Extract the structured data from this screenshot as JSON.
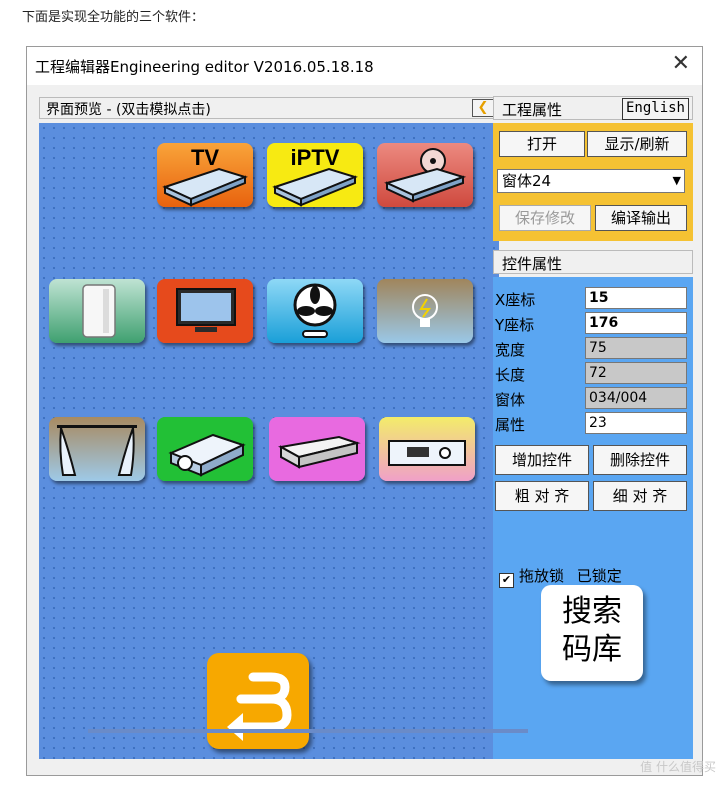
{
  "caption": "下面是实现全功能的三个软件：",
  "window": {
    "title": "工程编辑器Engineering editor V2016.05.18.18",
    "close_glyph": "✕"
  },
  "preview": {
    "header": "界面预览 - (双击模拟点击)",
    "back_glyph": "❮",
    "tiles": [
      {
        "name": "tv",
        "label": "TV"
      },
      {
        "name": "iptv",
        "label": "iPTV"
      },
      {
        "name": "dvd",
        "label": ""
      },
      {
        "name": "air-purifier",
        "label": ""
      },
      {
        "name": "television",
        "label": ""
      },
      {
        "name": "fan",
        "label": ""
      },
      {
        "name": "light",
        "label": ""
      },
      {
        "name": "curtain",
        "label": ""
      },
      {
        "name": "projector",
        "label": ""
      },
      {
        "name": "air-conditioner",
        "label": ""
      },
      {
        "name": "amplifier",
        "label": ""
      }
    ]
  },
  "project": {
    "header": "工程属性",
    "english_button": "English",
    "open_button": "打开",
    "refresh_button": "显示/刷新",
    "window_select": "窗体24",
    "save_button": "保存修改",
    "compile_button": "编译输出"
  },
  "control": {
    "header": "控件属性",
    "rows": [
      {
        "key": "X座标",
        "value": "15"
      },
      {
        "key": "Y座标",
        "value": "176"
      },
      {
        "key": "宽度",
        "value": "75"
      },
      {
        "key": "长度",
        "value": "72"
      },
      {
        "key": "窗体",
        "value": "034/004"
      },
      {
        "key": "属性",
        "value": "23"
      }
    ],
    "add_button": "增加控件",
    "delete_button": "删除控件",
    "coarse_align": "粗 对 齐",
    "fine_align": "细 对 齐",
    "drag_lock": "拖放锁",
    "lock_status": "已锁定",
    "search_line1": "搜索",
    "search_line2": "码库"
  },
  "watermark": "值 什么值得买"
}
